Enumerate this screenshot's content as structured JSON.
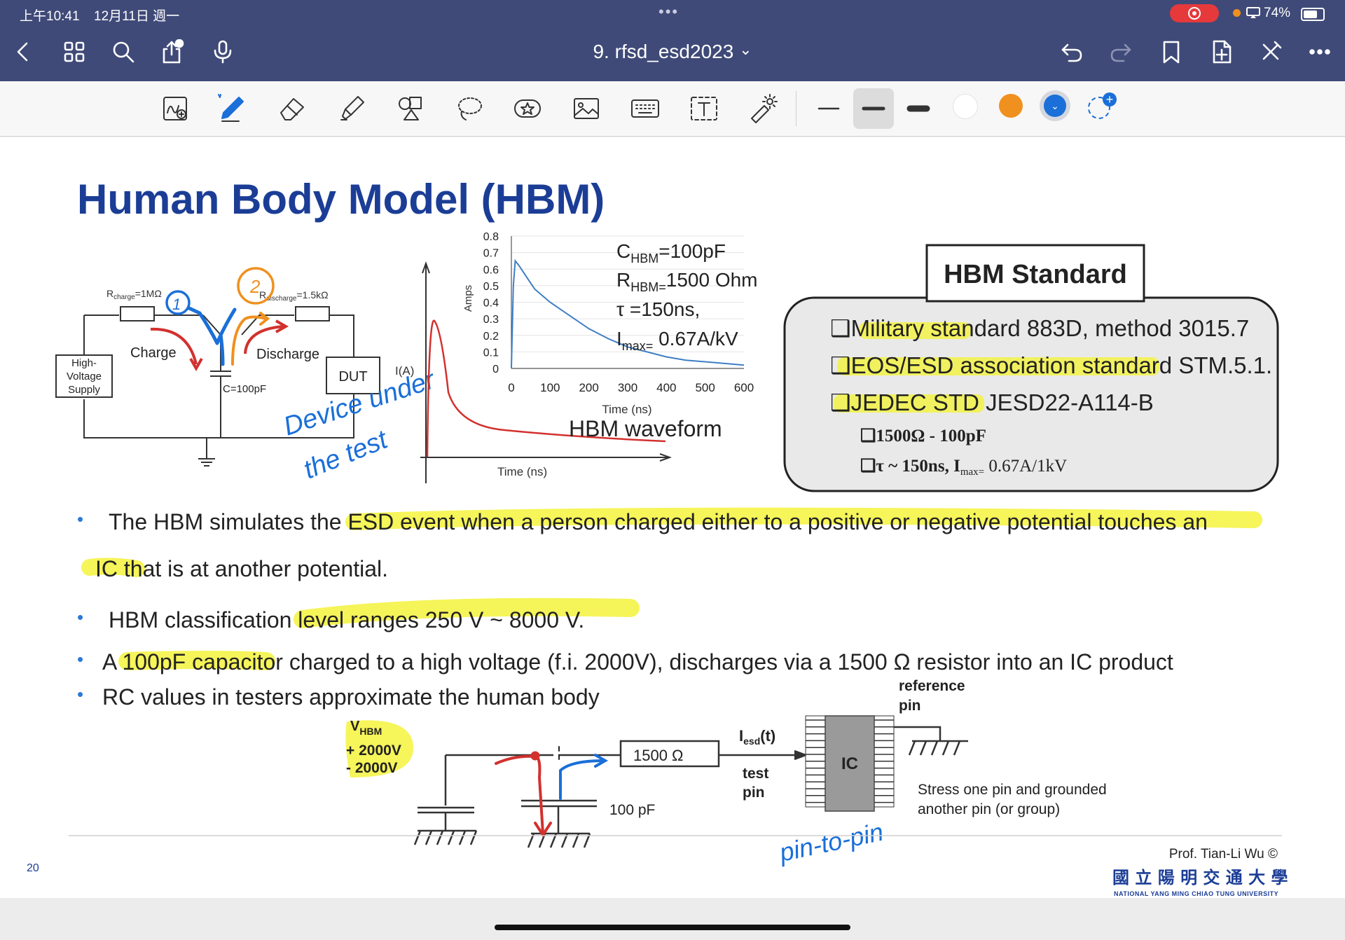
{
  "status": {
    "time": "上午10:41",
    "date": "12月11日 週一",
    "battery": "74%"
  },
  "nav": {
    "title": "9. rfsd_esd2023",
    "chevron": "⌄",
    "left_icons": [
      "back-icon",
      "grid-icon",
      "search-icon",
      "share-icon",
      "microphone-icon"
    ],
    "right_icons": [
      "undo-icon",
      "redo-icon",
      "bookmark-icon",
      "add-page-icon",
      "close-pen-icon",
      "more-icon"
    ]
  },
  "toolbar": {
    "tools": [
      "lasso-zoom-icon",
      "pen-icon",
      "eraser-icon",
      "highlighter-icon",
      "shapes-icon",
      "lasso-icon",
      "sticker-icon",
      "image-icon",
      "keyboard-icon",
      "text-icon",
      "laser-pointer-icon"
    ],
    "colors": {
      "white": "#ffffff",
      "orange": "#f0901e",
      "blue": "#1a6fd8",
      "add": "#1a6fd8"
    }
  },
  "slide": {
    "title": "Human Body Model (HBM)",
    "page_number": "20",
    "circuit": {
      "r_charge": "R",
      "r_charge_sub": "charge",
      "r_charge_val": "=1MΩ",
      "r_discharge": "R",
      "r_discharge_sub": "discharge",
      "r_discharge_val": "=1.5kΩ",
      "charge": "Charge",
      "discharge": "Discharge",
      "supply_l1": "High-",
      "supply_l2": "Voltage",
      "supply_l3": "Supply",
      "dut": "DUT",
      "cap": "C=100pF",
      "current_label": "I(A)",
      "time_label": "Time (ns)"
    },
    "chart": {
      "ylabel": "Amps",
      "xlabel": "Time (ns)",
      "params": {
        "c": "C",
        "c_sub": "HBM",
        "c_val": "=100pF",
        "r": "R",
        "r_sub": "HBM=",
        "r_val": "1500 Ohm",
        "tau": "τ =150ns,",
        "imax": "I",
        "imax_sub": "max=",
        "imax_val": " 0.67A/kV"
      },
      "caption": "HBM waveform"
    },
    "chart_data": {
      "type": "line",
      "xlabel": "Time (ns)",
      "ylabel": "Amps",
      "xlim": [
        0,
        600
      ],
      "ylim": [
        0,
        0.8
      ],
      "xticks": [
        0,
        100,
        200,
        300,
        400,
        500,
        600
      ],
      "yticks": [
        0,
        0.1,
        0.2,
        0.3,
        0.4,
        0.5,
        0.6,
        0.7,
        0.8
      ],
      "xtick_labels": [
        "0",
        "100",
        "200",
        "300",
        "400",
        "500",
        "600"
      ],
      "ytick_labels": [
        "0",
        "0.1",
        "0.2",
        "0.3",
        "0.4",
        "0.5",
        "0.6",
        "0.7",
        "0.8"
      ],
      "series": [
        {
          "x": [
            0,
            5,
            10,
            20,
            40,
            60,
            80,
            100,
            150,
            200,
            250,
            300,
            350,
            400,
            450,
            500,
            550,
            600
          ],
          "values": [
            0.0,
            0.5,
            0.65,
            0.62,
            0.55,
            0.48,
            0.44,
            0.4,
            0.32,
            0.24,
            0.18,
            0.13,
            0.1,
            0.07,
            0.05,
            0.04,
            0.03,
            0.02
          ]
        }
      ]
    },
    "standard": {
      "title": "HBM Standard",
      "items": [
        "❑Military standard 883D, method 3015.7",
        "❑EOS/ESD association standard STM.5.1.",
        "❑JEDEC STD JESD22-A114-B"
      ],
      "sub1": "❑1500Ω - 100pF",
      "sub2_pre": "❑τ ~ 150ns,  I",
      "sub2_sub": "max=",
      "sub2_post": " 0.67A/1kV"
    },
    "bullets": {
      "b1a": "The HBM simulates the ESD event when a person charged either to a positive or negative potential touches an",
      "b1b": "IC that is at another potential.",
      "b2": "HBM classification level ranges 250 V ~ 8000 V.",
      "b3": "A 100pF capacitor charged to a high voltage (f.i. 2000V), discharges via a 1500 Ω resistor into an IC product",
      "b4": "RC values in testers approximate the human body"
    },
    "bottom": {
      "vhbm": "V",
      "vhbm_sub": "HBM",
      "plus": "+ 2000V",
      "minus": "-  2000V",
      "resistor": "1500 Ω",
      "iesd": "I",
      "iesd_sub": "esd",
      "iesd_post": "(t)",
      "test1": "test",
      "test2": "pin",
      "cap": "100 pF",
      "ic": "IC",
      "ref1": "reference",
      "ref2": "pin",
      "stress1": "Stress one pin and grounded",
      "stress2": "another pin (or group)"
    },
    "footer": {
      "prof": "Prof. Tian-Li Wu ©",
      "school_cn": "國 立 陽 明 交 通 大 學",
      "school_en": "NATIONAL YANG MING CHIAO TUNG UNIVERSITY"
    },
    "handwriting": {
      "one": "1",
      "two": "2",
      "dut_note1": "Device under",
      "dut_note2": "the test",
      "pin_note": "pin-to-pin"
    }
  }
}
